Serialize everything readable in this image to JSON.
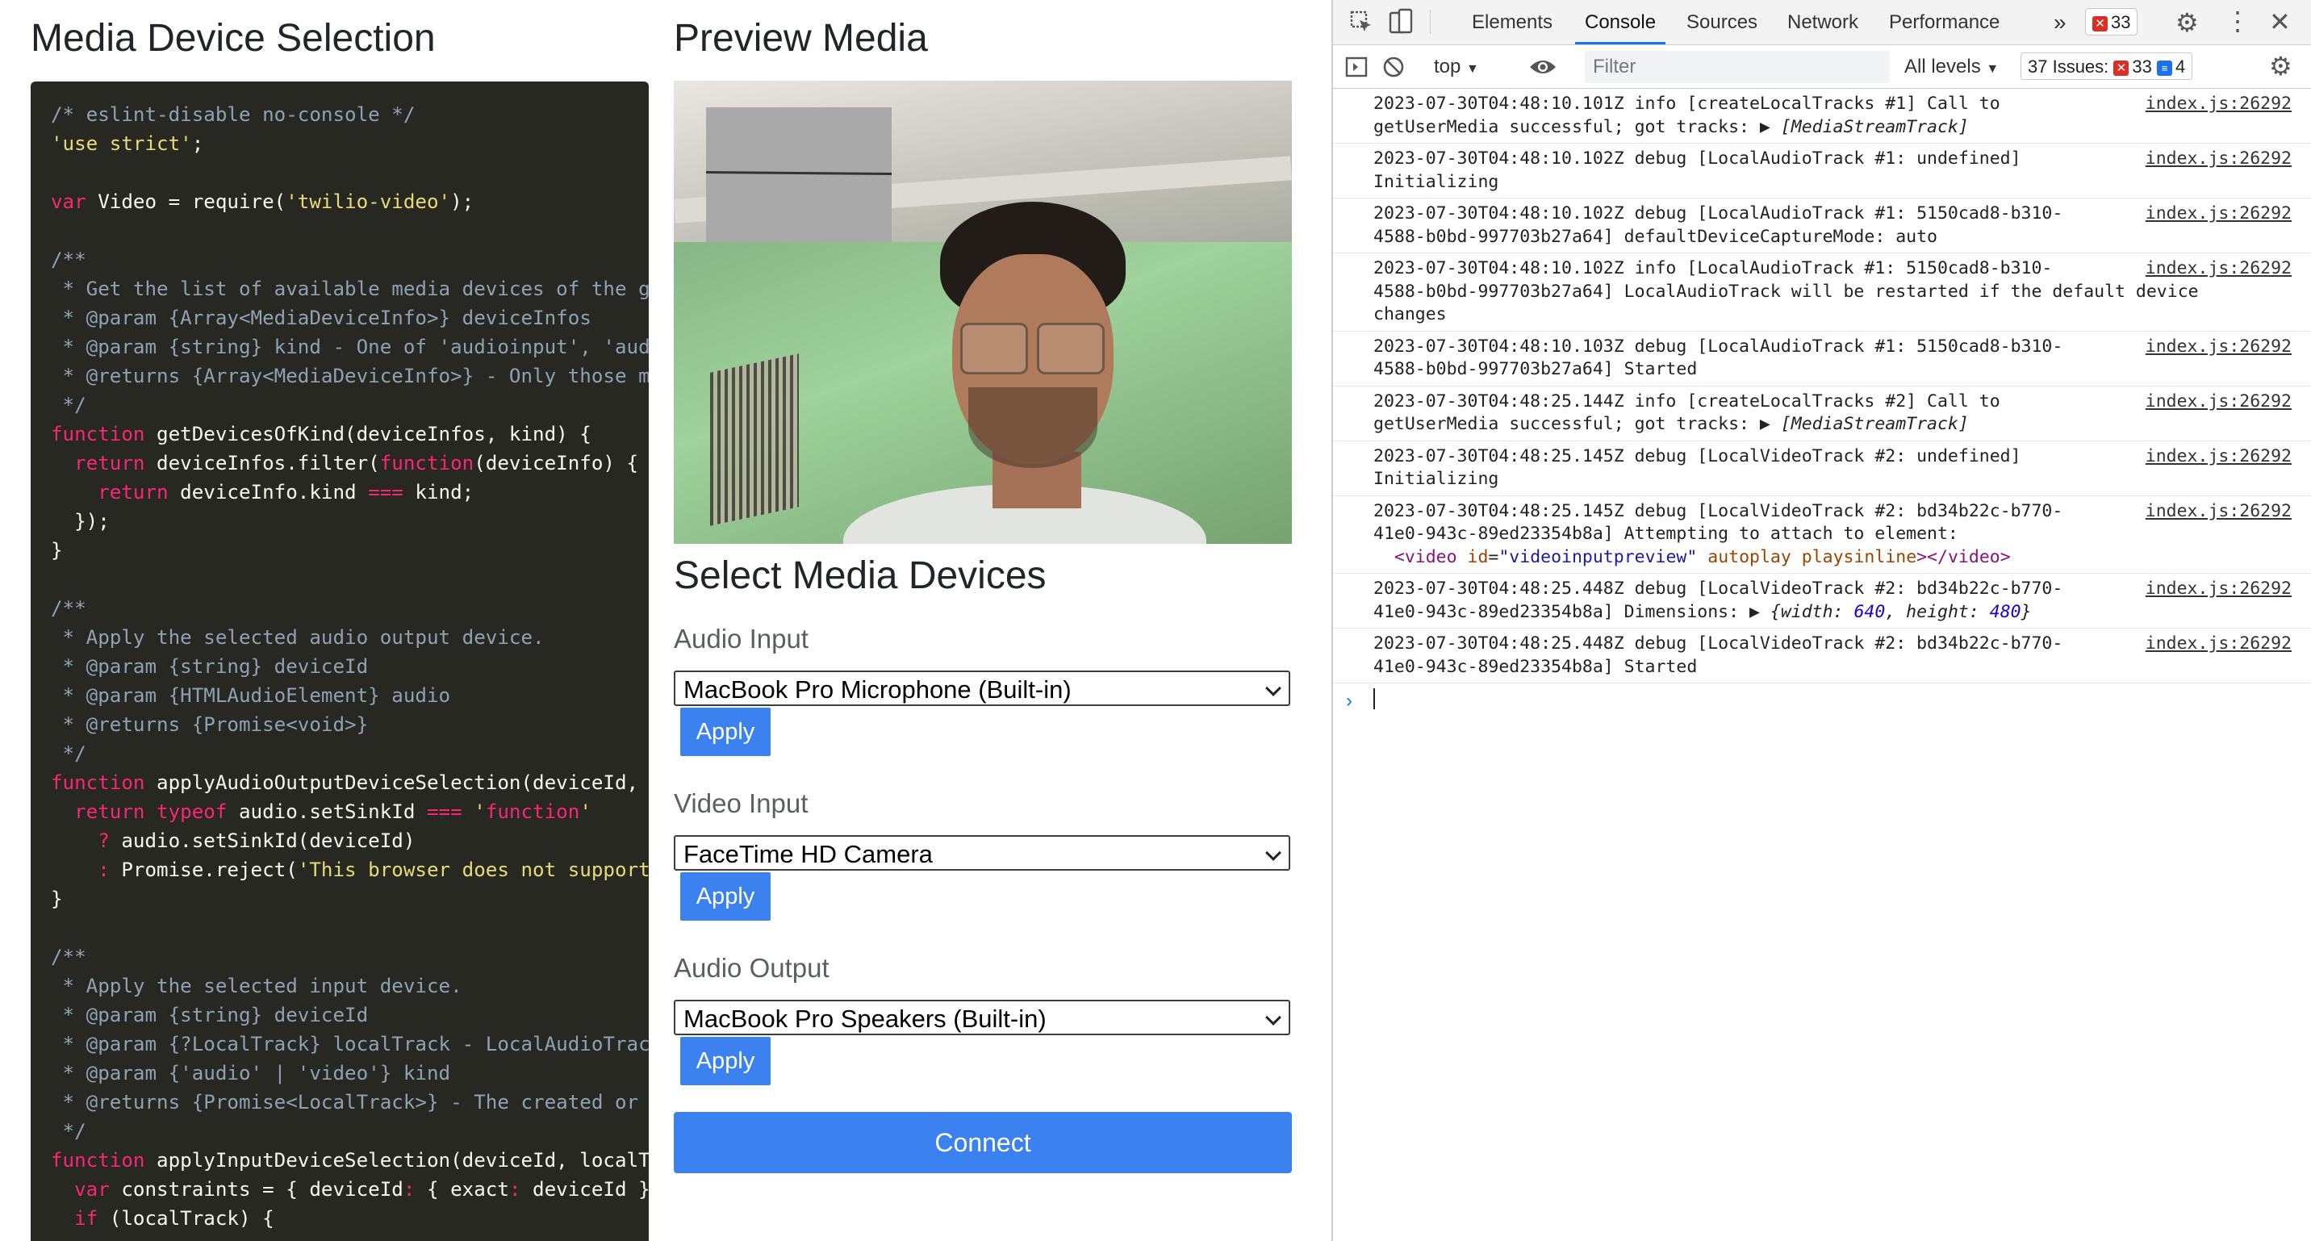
{
  "page": {
    "left_title": "Media Device Selection",
    "right_title": "Preview Media",
    "select_title": "Select Media Devices",
    "audio_input_label": "Audio Input",
    "audio_input_value": "MacBook Pro Microphone (Built-in)",
    "video_input_label": "Video Input",
    "video_input_value": "FaceTime HD Camera",
    "audio_output_label": "Audio Output",
    "audio_output_value": "MacBook Pro Speakers (Built-in)",
    "apply_label": "Apply",
    "connect_label": "Connect"
  },
  "code_lines": [
    "/* eslint-disable no-console */",
    "'use strict';",
    "",
    "var Video = require('twilio-video');",
    "",
    "/**",
    " * Get the list of available media devices of the gi",
    " * @param {Array<MediaDeviceInfo>} deviceInfos",
    " * @param {string} kind - One of 'audioinput', 'audi",
    " * @returns {Array<MediaDeviceInfo>} - Only those me",
    " */",
    "function getDevicesOfKind(deviceInfos, kind) {",
    "  return deviceInfos.filter(function(deviceInfo) {",
    "    return deviceInfo.kind === kind;",
    "  });",
    "}",
    "",
    "/**",
    " * Apply the selected audio output device.",
    " * @param {string} deviceId",
    " * @param {HTMLAudioElement} audio",
    " * @returns {Promise<void>}",
    " */",
    "function applyAudioOutputDeviceSelection(deviceId, a",
    "  return typeof audio.setSinkId === 'function'",
    "    ? audio.setSinkId(deviceId)",
    "    : Promise.reject('This browser does not support",
    "}",
    "",
    "/**",
    " * Apply the selected input device.",
    " * @param {string} deviceId",
    " * @param {?LocalTrack} localTrack - LocalAudioTrack",
    " * @param {'audio' | 'video'} kind",
    " * @returns {Promise<LocalTrack>} - The created or r",
    " */",
    "function applyInputDeviceSelection(deviceId, localTr",
    "  var constraints = { deviceId: { exact: deviceId }",
    "  if (localTrack) {"
  ],
  "devtools": {
    "tabs": [
      "Elements",
      "Console",
      "Sources",
      "Network",
      "Performance"
    ],
    "active_tab": "Console",
    "more": "»",
    "error_count": "33",
    "context": "top",
    "filter_placeholder": "Filter",
    "levels": "All levels",
    "issues_label": "37 Issues:",
    "issues_errors": "33",
    "issues_info": "4",
    "logs": [
      {
        "text": "2023-07-30T04:48:10.101Z info [createLocalTracks #1] Call to\ngetUserMedia successful; got tracks: ▶ ",
        "italic": "[MediaStreamTrack]",
        "src": "index.js:26292"
      },
      {
        "text": "2023-07-30T04:48:10.102Z debug [LocalAudioTrack #1: undefined]\nInitializing",
        "src": "index.js:26292"
      },
      {
        "text": "2023-07-30T04:48:10.102Z debug [LocalAudioTrack #1: 5150cad8-b310-\n4588-b0bd-997703b27a64] defaultDeviceCaptureMode: auto",
        "src": "index.js:26292"
      },
      {
        "text": "2023-07-30T04:48:10.102Z info [LocalAudioTrack #1: 5150cad8-b310-\n4588-b0bd-997703b27a64] LocalAudioTrack will be restarted if the default device\nchanges",
        "src": "index.js:26292"
      },
      {
        "text": "2023-07-30T04:48:10.103Z debug [LocalAudioTrack #1: 5150cad8-b310-\n4588-b0bd-997703b27a64] Started",
        "src": "index.js:26292"
      },
      {
        "text": "2023-07-30T04:48:25.144Z info [createLocalTracks #2] Call to\ngetUserMedia successful; got tracks: ▶ ",
        "italic": "[MediaStreamTrack]",
        "src": "index.js:26292"
      },
      {
        "text": "2023-07-30T04:48:25.145Z debug [LocalVideoTrack #2: undefined]\nInitializing",
        "src": "index.js:26292"
      },
      {
        "text": "2023-07-30T04:48:25.145Z debug [LocalVideoTrack #2: bd34b22c-b770-\n41e0-943c-89ed23354b8a] Attempting to attach to element:",
        "element": "<video id=\"videoinputpreview\" autoplay playsinline></video>",
        "src": "index.js:26292"
      },
      {
        "text": "2023-07-30T04:48:25.448Z debug [LocalVideoTrack #2: bd34b22c-b770-\n41e0-943c-89ed23354b8a] Dimensions: ▶ ",
        "italic": "{width: 640, height: 480}",
        "src": "index.js:26292"
      },
      {
        "text": "2023-07-30T04:48:25.448Z debug [LocalVideoTrack #2: bd34b22c-b770-\n41e0-943c-89ed23354b8a] Started",
        "src": "index.js:26292"
      }
    ],
    "prompt": "›"
  }
}
